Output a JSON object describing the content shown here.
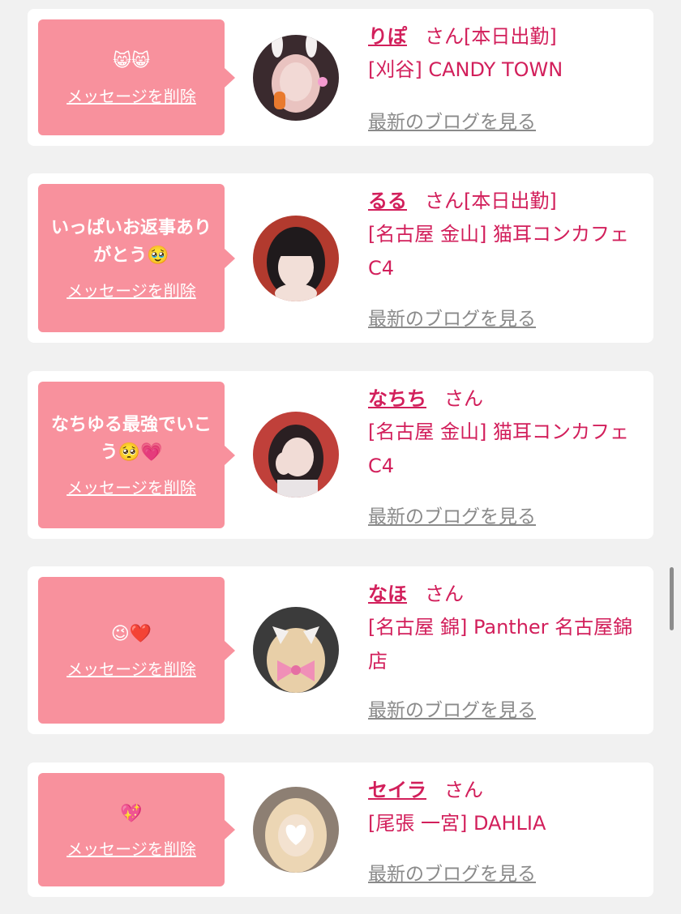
{
  "messages": [
    {
      "message": "😸😸",
      "delete_label": "メッセージを削除",
      "name": "りぽ",
      "honorific": "さん",
      "status": "[本日出勤]",
      "shop": "[刈谷] CANDY TOWN",
      "blog_link": "最新のブログを見る",
      "avatar_colors": [
        "#3a2a2e",
        "#e9c3c0",
        "#f2d9d5"
      ]
    },
    {
      "message": "いっぱいお返事ありがとう🥹",
      "delete_label": "メッセージを削除",
      "name": "るる",
      "honorific": "さん",
      "status": "[本日出勤]",
      "shop": "[名古屋 金山] 猫耳コンカフェ C4",
      "blog_link": "最新のブログを見る",
      "avatar_colors": [
        "#b23a2e",
        "#1f1a1c",
        "#f2dfd8"
      ]
    },
    {
      "message": "なちゆる最強でいこう🥺💗",
      "delete_label": "メッセージを削除",
      "name": "なちち",
      "honorific": "さん",
      "status": "",
      "shop": "[名古屋 金山] 猫耳コンカフェ C4",
      "blog_link": "最新のブログを見る",
      "avatar_colors": [
        "#c0403a",
        "#2a1f22",
        "#f1dcd6"
      ]
    },
    {
      "message": "😉❤️",
      "delete_label": "メッセージを削除",
      "name": "なほ",
      "honorific": "さん",
      "status": "",
      "shop": "[名古屋 錦] Panther 名古屋錦店",
      "blog_link": "最新のブログを見る",
      "avatar_colors": [
        "#3b3b3b",
        "#e8cfa8",
        "#f08fb7"
      ]
    },
    {
      "message": "💖",
      "delete_label": "メッセージを削除",
      "name": "セイラ",
      "honorific": "さん",
      "status": "",
      "shop": "[尾張 一宮] DAHLIA",
      "blog_link": "最新のブログを見る",
      "avatar_colors": [
        "#8d7f73",
        "#ecd6b4",
        "#ffffff"
      ]
    }
  ]
}
